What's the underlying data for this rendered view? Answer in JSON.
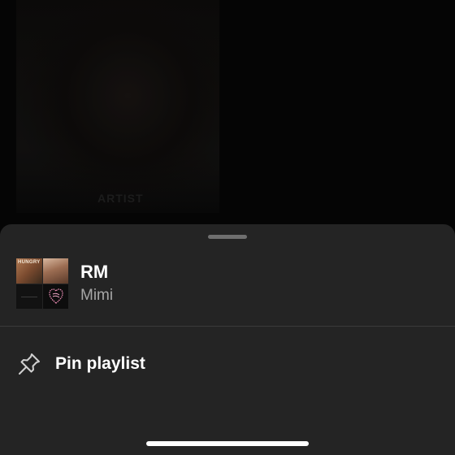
{
  "backdrop": {
    "ghost_text": "ARTIST"
  },
  "playlist": {
    "title": "RM",
    "owner": "Mimi",
    "cover_tiles": [
      {
        "icon": "album-cover-icon",
        "label": "HUNGRY"
      },
      {
        "icon": "album-cover-icon"
      },
      {
        "icon": "album-cover-icon"
      },
      {
        "icon": "album-cover-icon"
      }
    ]
  },
  "actions": [
    {
      "label": "Pin playlist",
      "icon": "pin-icon"
    }
  ],
  "colors": {
    "sheet_background": "#242424",
    "primary_text": "#ffffff",
    "secondary_text": "#a7a7a7",
    "divider": "#3a3a3a"
  }
}
